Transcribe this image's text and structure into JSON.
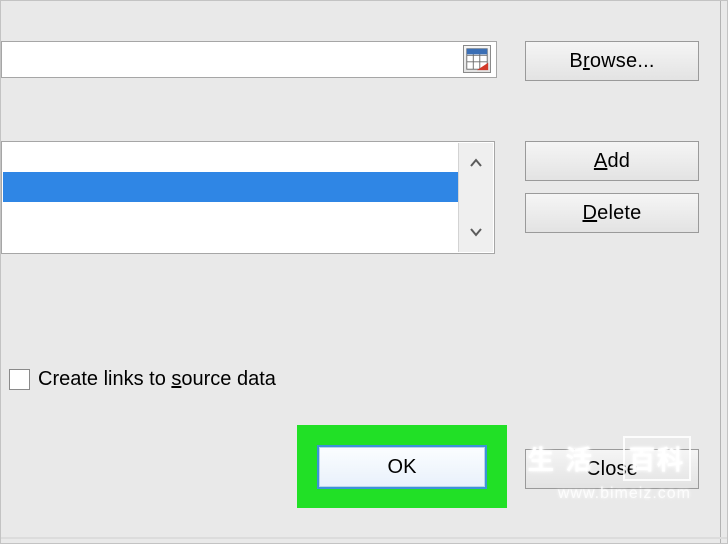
{
  "reference_field": {
    "value": ""
  },
  "buttons": {
    "browse_pre": "B",
    "browse_u": "r",
    "browse_post": "owse...",
    "add_pre": "",
    "add_u": "A",
    "add_post": "dd",
    "delete_pre": "",
    "delete_u": "D",
    "delete_post": "elete",
    "ok": "OK",
    "close": "Close"
  },
  "listbox": {
    "selected_index": 0,
    "items": [
      ""
    ]
  },
  "checkbox": {
    "checked": false,
    "label_pre": "Create links to ",
    "label_u": "s",
    "label_post": "ource data"
  },
  "watermark": {
    "cn_left": "生活",
    "cn_right": "百科",
    "url": "www.bimeiz.com"
  },
  "colors": {
    "selection": "#2f86e5",
    "highlight": "#21e026",
    "focus_ring": "#3c93d8"
  }
}
